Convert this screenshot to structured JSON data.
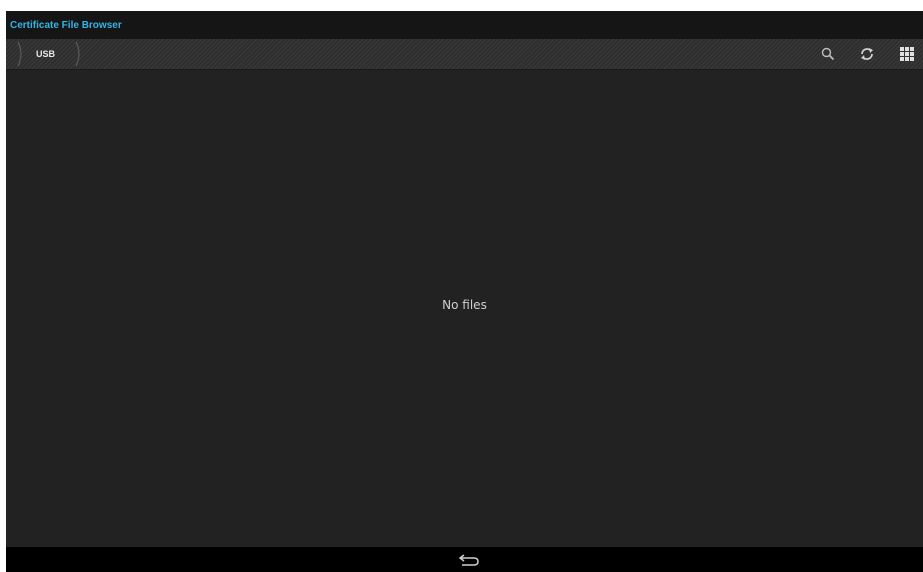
{
  "app": {
    "title": "Certificate File Browser",
    "accent_color": "#33b5e5"
  },
  "toolbar": {
    "breadcrumb": [
      "USB"
    ],
    "actions": [
      {
        "name": "search",
        "icon": "search-icon"
      },
      {
        "name": "refresh",
        "icon": "refresh-icon"
      },
      {
        "name": "grid-view",
        "icon": "grid-view-icon"
      }
    ]
  },
  "content": {
    "empty_message": "No files"
  },
  "navigation": {
    "back_icon": "back-icon"
  }
}
